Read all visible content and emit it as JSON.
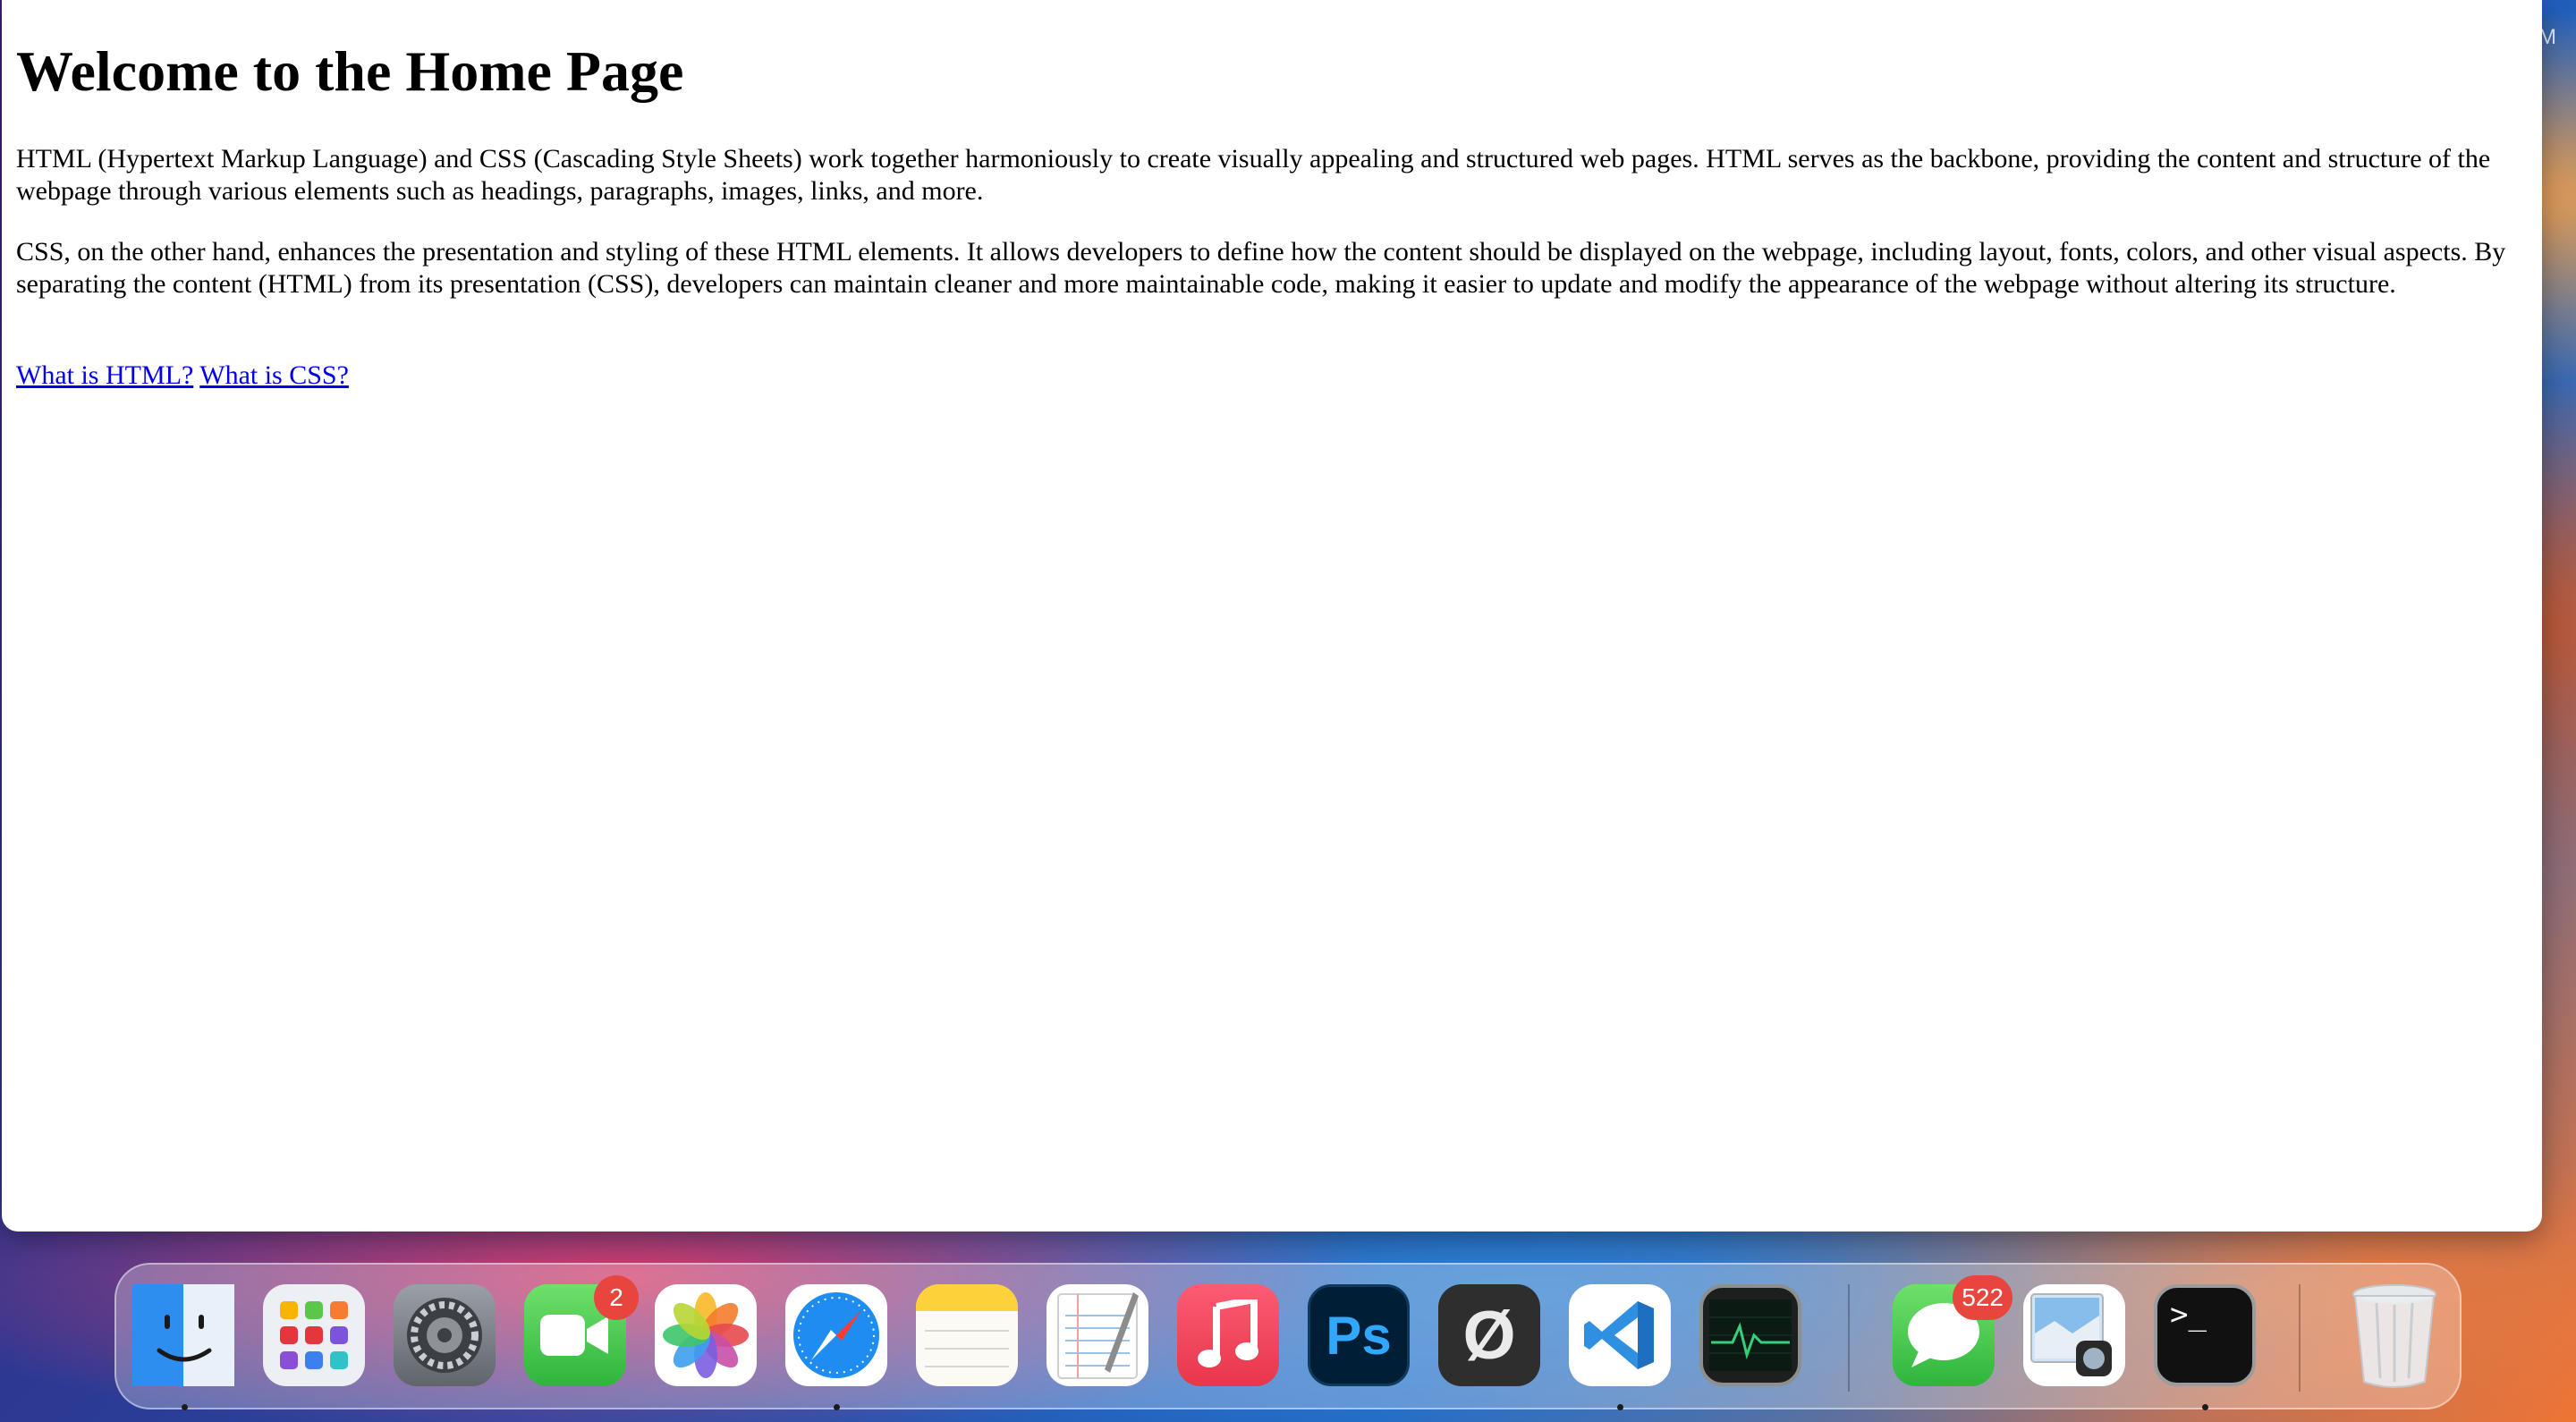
{
  "desktop": {
    "menubar_clock_fragment": "M"
  },
  "page": {
    "heading": "Welcome to the Home Page",
    "paragraph1": "HTML (Hypertext Markup Language) and CSS (Cascading Style Sheets) work together harmoniously to create visually appealing and structured web pages. HTML serves as the backbone, providing the content and structure of the webpage through various elements such as headings, paragraphs, images, links, and more.",
    "paragraph2": "CSS, on the other hand, enhances the presentation and styling of these HTML elements. It allows developers to define how the content should be displayed on the webpage, including layout, fonts, colors, and other visual aspects. By separating the content (HTML) from its presentation (CSS), developers can maintain cleaner and more maintainable code, making it easier to update and modify the appearance of the webpage without altering its structure.",
    "links": [
      {
        "label": "What is HTML?"
      },
      {
        "label": "What is CSS?"
      }
    ],
    "link_color": "#0000ee"
  },
  "dock": {
    "apps": [
      {
        "name": "Finder",
        "icon": "finder-icon",
        "running": true
      },
      {
        "name": "Launchpad",
        "icon": "launchpad-icon",
        "running": false
      },
      {
        "name": "System Settings",
        "icon": "settings-gear-icon",
        "running": false
      },
      {
        "name": "FaceTime",
        "icon": "facetime-icon",
        "running": false,
        "badge": "2"
      },
      {
        "name": "Photos",
        "icon": "photos-icon",
        "running": false
      },
      {
        "name": "Safari",
        "icon": "safari-compass-icon",
        "running": true
      },
      {
        "name": "Notes",
        "icon": "notes-icon",
        "running": false
      },
      {
        "name": "TextEdit",
        "icon": "textedit-icon",
        "running": false
      },
      {
        "name": "Music",
        "icon": "music-note-icon",
        "running": false
      },
      {
        "name": "Photoshop",
        "icon": "photoshop-icon",
        "label": "Ps",
        "running": false
      },
      {
        "name": "Null App",
        "icon": "null-symbol-icon",
        "label": "Ø",
        "running": false
      },
      {
        "name": "Visual Studio Code",
        "icon": "vscode-icon",
        "running": true
      },
      {
        "name": "Activity Monitor",
        "icon": "activity-monitor-icon",
        "running": false
      },
      {
        "name": "Messages",
        "icon": "messages-bubble-icon",
        "running": false,
        "badge": "522"
      },
      {
        "name": "Preview",
        "icon": "preview-icon",
        "running": false
      },
      {
        "name": "Terminal",
        "icon": "terminal-icon",
        "label": ">_",
        "running": true
      },
      {
        "name": "Trash",
        "icon": "trash-icon",
        "running": false
      }
    ]
  }
}
